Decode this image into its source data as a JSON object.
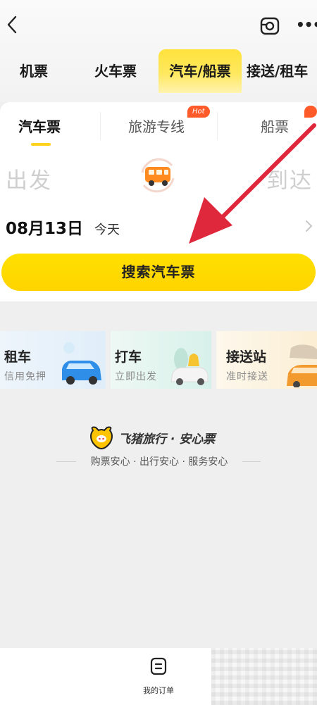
{
  "header": {
    "icons": {
      "back": "chevron-left-icon",
      "share": "share-icon",
      "more": "more-dots-icon"
    },
    "more_glyph": "•••",
    "tabs": [
      {
        "label": "机票",
        "active": false
      },
      {
        "label": "火车票",
        "active": false
      },
      {
        "label": "汽车/船票",
        "active": true
      },
      {
        "label": "接送/租车",
        "active": false
      }
    ]
  },
  "search": {
    "sub_tabs": [
      {
        "label": "汽车票",
        "active": true
      },
      {
        "label": "旅游专线",
        "badge": "Hot"
      },
      {
        "label": "船票"
      }
    ],
    "from_placeholder": "出发",
    "to_placeholder": "到达",
    "date": "08月13日",
    "day": "今天",
    "button_label": "搜索汽车票",
    "swap_icon": "bus-swap-icon"
  },
  "services": [
    {
      "name": "租车",
      "desc": "信用免押",
      "icon": "blue-car-icon"
    },
    {
      "name": "打车",
      "desc": "立即出发",
      "icon": "taxi-icon"
    },
    {
      "name": "接送站",
      "desc": "准时接送",
      "icon": "pickup-car-icon"
    }
  ],
  "brand": {
    "name": "飞猪旅行 · 安心票",
    "slogan": "购票安心 · 出行安心 · 服务安心"
  },
  "bottom_bar": {
    "orders_label": "我的订单"
  },
  "colors": {
    "accent_yellow": "#ffd400",
    "annotation_red": "#e0283c",
    "hot_badge": "#ff5a2a"
  }
}
